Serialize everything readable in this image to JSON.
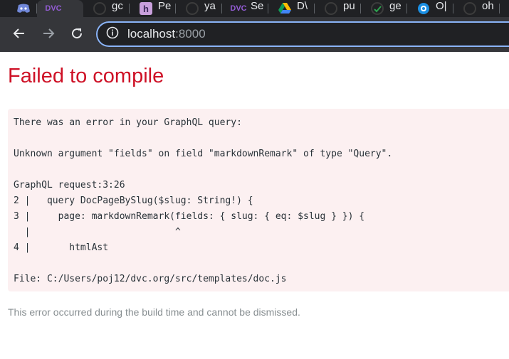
{
  "browser": {
    "tabs": [
      {
        "label": "",
        "icon": "discord-icon"
      },
      {
        "label": "",
        "icon": "dvc-icon",
        "active": true
      },
      {
        "label": "gc",
        "icon": "github-icon"
      },
      {
        "label": "Pe",
        "icon": "heroku-icon"
      },
      {
        "label": "ya",
        "icon": "github-icon"
      },
      {
        "label": "Se",
        "icon": "dvc-icon"
      },
      {
        "label": "D\\",
        "icon": "google-drive-icon"
      },
      {
        "label": "pu",
        "icon": "github-icon"
      },
      {
        "label": "ge",
        "icon": "github-check-icon"
      },
      {
        "label": "O|",
        "icon": "circle-logo-icon"
      },
      {
        "label": "oh",
        "icon": "github-icon"
      },
      {
        "label": "",
        "icon": "github-check-icon"
      }
    ],
    "url_host": "localhost",
    "url_port": ":8000"
  },
  "page": {
    "title": "Failed to compile",
    "error_lines": [
      "There was an error in your GraphQL query:",
      "",
      "Unknown argument \"fields\" on field \"markdownRemark\" of type \"Query\".",
      "",
      "GraphQL request:3:26",
      "2 |   query DocPageBySlug($slug: String!) {",
      "3 |     page: markdownRemark(fields: { slug: { eq: $slug } }) {",
      "  |                          ^",
      "4 |       htmlAst",
      "",
      "File: C:/Users/poj12/dvc.org/src/templates/doc.js"
    ],
    "footer_note": "This error occurred during the build time and cannot be dismissed."
  },
  "colors": {
    "title_red": "#ce1126",
    "error_bg": "#fcf0f1",
    "omnibox_focus": "#8ab4f8"
  }
}
